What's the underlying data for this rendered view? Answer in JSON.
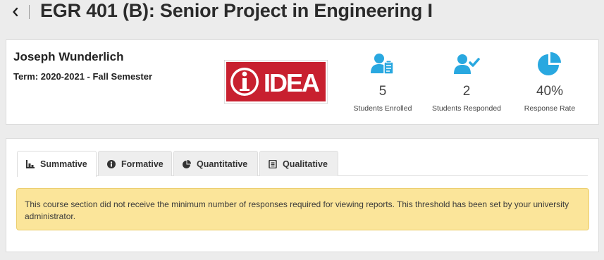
{
  "header": {
    "title": "EGR 401 (B): Senior Project in Engineering I"
  },
  "instructor": {
    "name": "Joseph Wunderlich",
    "term": "Term: 2020-2021 - Fall Semester"
  },
  "logo": {
    "text": "IDEA",
    "colors": {
      "red": "#c8202f",
      "white": "#ffffff"
    }
  },
  "stats": [
    {
      "icon": "students-enrolled-icon",
      "value": "5",
      "label": "Students Enrolled"
    },
    {
      "icon": "students-responded-icon",
      "value": "2",
      "label": "Students Responded"
    },
    {
      "icon": "response-rate-pie-icon",
      "value": "40%",
      "label": "Response Rate"
    }
  ],
  "tabs": [
    {
      "label": "Summative",
      "icon": "bar-chart-icon",
      "active": true
    },
    {
      "label": "Formative",
      "icon": "info-circle-icon",
      "active": false
    },
    {
      "label": "Quantitative",
      "icon": "pie-chart-icon",
      "active": false
    },
    {
      "label": "Qualitative",
      "icon": "document-icon",
      "active": false
    }
  ],
  "alert": {
    "message": "This course section did not receive the minimum number of responses required for viewing reports. This threshold has been set by your university administrator."
  },
  "colors": {
    "accent": "#29a8e0",
    "alert_bg": "#fbe59a",
    "alert_border": "#ecce6f"
  }
}
